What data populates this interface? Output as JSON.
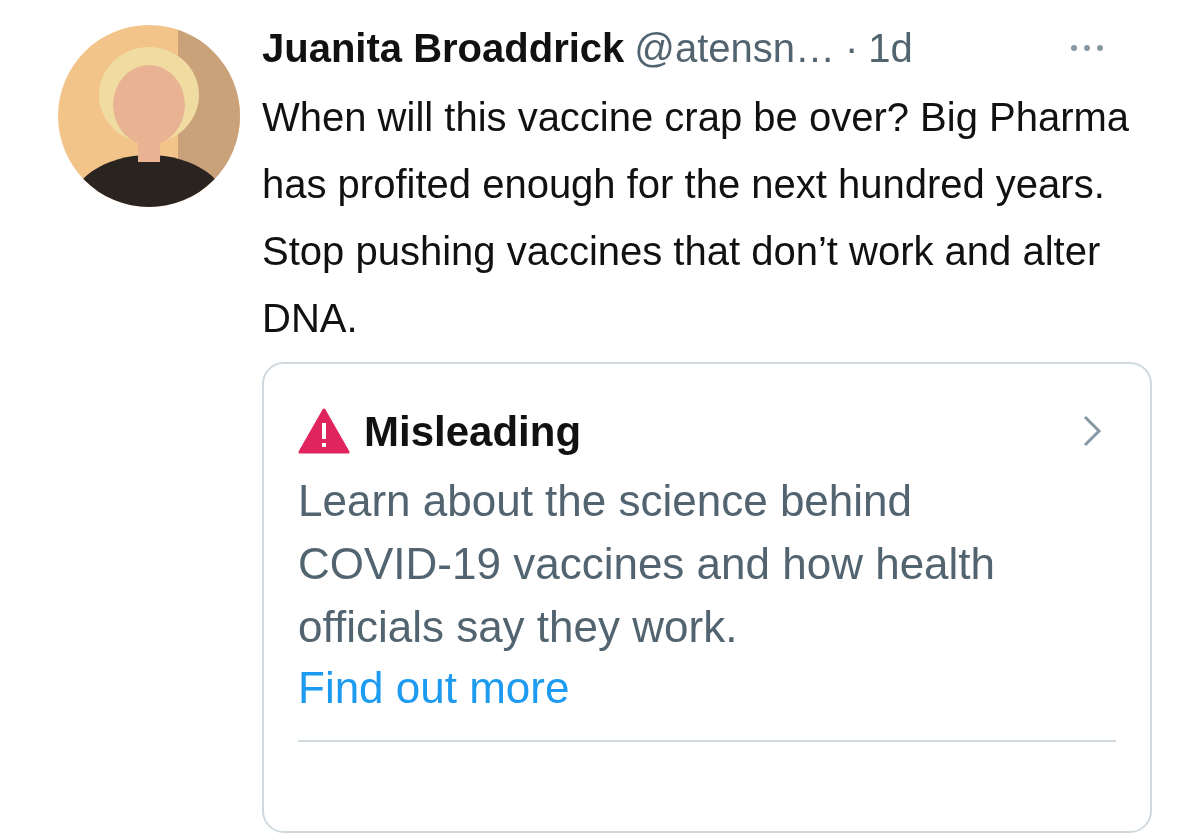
{
  "tweet": {
    "author": {
      "name": "Juanita Broaddrick",
      "handle": "@atensn…",
      "separator": "·",
      "time": "1d"
    },
    "text": "When will this vaccine crap be over? Big Pharma has profited enough for the next hundred years.  Stop pushing vaccines that don’t work and alter DNA.",
    "notice": {
      "title": "Misleading",
      "body": "Learn about the science behind COVID-19 vaccines and how health officials say they work.",
      "link": "Find out more"
    }
  }
}
